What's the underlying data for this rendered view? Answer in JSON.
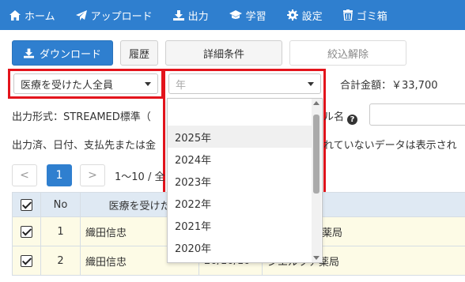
{
  "nav": {
    "items": [
      {
        "label": "ホーム",
        "icon": "home-icon"
      },
      {
        "label": "アップロード",
        "icon": "paper-plane-icon"
      },
      {
        "label": "出力",
        "icon": "download-icon"
      },
      {
        "label": "学習",
        "icon": "graduation-cap-icon"
      },
      {
        "label": "設定",
        "icon": "gear-icon"
      },
      {
        "label": "ゴミ箱",
        "icon": "trash-icon"
      }
    ]
  },
  "toolbar": {
    "download_label": "ダウンロード",
    "history_label": "履歴",
    "detail_label": "詳細条件",
    "clear_label": "絞込解除"
  },
  "filters": {
    "patient_value": "医療を受けた人全員",
    "year_placeholder": "年",
    "total_label": "合計金額：￥33,700"
  },
  "info": {
    "format_left": "出力形式：STREAMED標準（",
    "format_right": "ル名",
    "note_left": "出力済、日付、支払先または金",
    "note_right": "れていないデータは表示され"
  },
  "pagination": {
    "prev": "<",
    "current": "1",
    "next": ">",
    "info": "1〜10 / 全"
  },
  "table": {
    "headers": {
      "no": "No",
      "name": "医療を受けた"
    },
    "rows": [
      {
        "no": "1",
        "name": "織田信忠",
        "date": "",
        "payee": "薬局"
      },
      {
        "no": "2",
        "name": "織田信忠",
        "date": "20/10/10",
        "payee": "シエルツア薬局"
      }
    ]
  },
  "year_dropdown": {
    "options": [
      "2025年",
      "2024年",
      "2023年",
      "2022年",
      "2021年",
      "2020年"
    ],
    "highlighted": "2025年"
  },
  "colors": {
    "nav_bg": "#2f7fcf",
    "primary": "#2f7fcf",
    "highlight_border": "#e3141c",
    "row_bg": "#fdfbe6",
    "header_bg": "#dfe9f3"
  }
}
